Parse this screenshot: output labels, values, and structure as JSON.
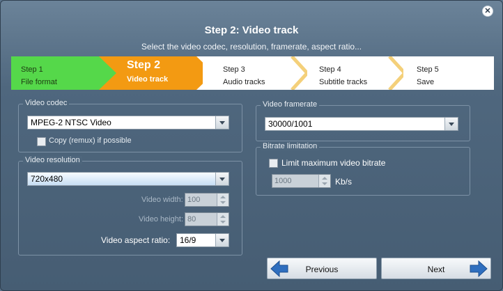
{
  "dialog": {
    "title": "Step 2: Video track",
    "subtitle": "Select the video codec, resolution, framerate, aspect ratio..."
  },
  "steps": [
    {
      "step": "Step 1",
      "label": "File format",
      "state": "done",
      "color": "#55d84a"
    },
    {
      "step": "Step 2",
      "label": "Video track",
      "state": "active",
      "color": "#f39a12"
    },
    {
      "step": "Step 3",
      "label": "Audio tracks",
      "state": "pending"
    },
    {
      "step": "Step 4",
      "label": "Subtitle tracks",
      "state": "pending"
    },
    {
      "step": "Step 5",
      "label": "Save",
      "state": "pending"
    }
  ],
  "video_codec": {
    "group_title": "Video codec",
    "value": "MPEG-2 NTSC Video",
    "copy_label": "Copy (remux) if possible",
    "copy_checked": false
  },
  "video_resolution": {
    "group_title": "Video resolution",
    "value": "720x480",
    "width_label": "Video width:",
    "width_value": "100",
    "height_label": "Video height:",
    "height_value": "80",
    "aspect_label": "Video aspect ratio:",
    "aspect_value": "16/9"
  },
  "video_framerate": {
    "group_title": "Video framerate",
    "value": "30000/1001"
  },
  "bitrate": {
    "group_title": "Bitrate limitation",
    "limit_label": "Limit maximum video bitrate",
    "limit_checked": false,
    "value": "1000",
    "unit": "Kb/s"
  },
  "buttons": {
    "previous": "Previous",
    "next": "Next"
  },
  "icons": {
    "close": "close-icon",
    "previous": "arrow-left-icon",
    "next": "arrow-right-icon",
    "dropdown": "chevron-down-icon"
  },
  "colors": {
    "arrow_blue": "#2f6fbf",
    "step_done": "#55d84a",
    "step_active": "#f39a12"
  }
}
